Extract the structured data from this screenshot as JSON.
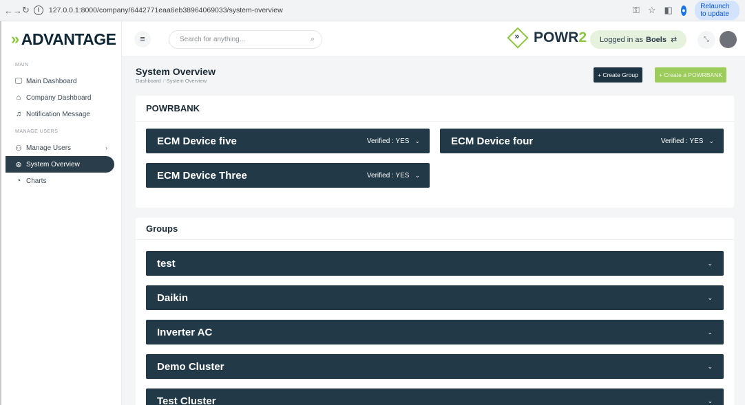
{
  "browser": {
    "url": "127.0.0.1:8000/company/6442771eaa6eb38964069033/system-overview",
    "relaunch_label": "Relaunch to update"
  },
  "sidebar": {
    "brand": "ADVANTAGE",
    "sections": [
      {
        "label": "MAIN"
      },
      {
        "label": "MANAGE USERS"
      }
    ],
    "items": [
      {
        "label": "Main Dashboard",
        "icon": "monitor-icon"
      },
      {
        "label": "Company Dashboard",
        "icon": "home-icon"
      },
      {
        "label": "Notification Message",
        "icon": "bell-icon"
      },
      {
        "label": "Manage Users",
        "icon": "users-icon"
      },
      {
        "label": "System Overview",
        "icon": "globe-icon",
        "active": true
      },
      {
        "label": "Charts",
        "icon": "pie-chart-icon"
      }
    ]
  },
  "header": {
    "search_placeholder": "Search for anything...",
    "logo_main": "POWR",
    "logo_accent": "2",
    "logged_in_prefix": "Logged in as",
    "logged_in_user": "Boels"
  },
  "page": {
    "title": "System Overview",
    "breadcrumb": [
      "Dashboard",
      "System Overview"
    ],
    "create_group_label": "+ Create Group",
    "create_powrbank_label": "+ Create a POWRBANK"
  },
  "powrbank": {
    "heading": "POWRBANK",
    "devices": [
      {
        "name": "ECM Device five",
        "verified": "Verified : YES"
      },
      {
        "name": "ECM Device four",
        "verified": "Verified : YES"
      },
      {
        "name": "ECM Device Three",
        "verified": "Verified : YES"
      }
    ]
  },
  "groups": {
    "heading": "Groups",
    "items": [
      {
        "name": "test"
      },
      {
        "name": "Daikin"
      },
      {
        "name": "Inverter AC"
      },
      {
        "name": "Demo Cluster"
      },
      {
        "name": "Test Cluster"
      }
    ]
  },
  "colors": {
    "navy": "#223a48",
    "accent_green": "#8cc63f",
    "button_green": "#9ccc5b"
  }
}
